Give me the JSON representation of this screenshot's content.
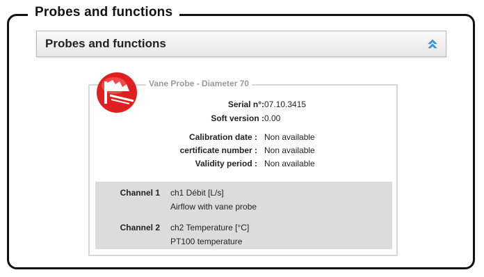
{
  "outer_title": "Probes and functions",
  "panel": {
    "title": "Probes and functions",
    "collapse_icon": "double-chevron-up-icon"
  },
  "probe": {
    "name": "Vane Probe - Diameter 70",
    "icon": "vane-probe-icon",
    "info": [
      {
        "label": "Serial n°:",
        "value": "07.10.3415"
      },
      {
        "label": "Soft version :",
        "value": "0.00"
      }
    ],
    "calibration": [
      {
        "label": "Calibration date :",
        "value": "Non available"
      },
      {
        "label": "certificate number :",
        "value": "Non available"
      },
      {
        "label": "Validity period :",
        "value": "Non available"
      }
    ],
    "channels": [
      {
        "label": "Channel 1",
        "line1": "ch1 Débit [L/s]",
        "line2": "Airflow with vane probe"
      },
      {
        "label": "Channel 2",
        "line1": "ch2 Temperature [°C]",
        "line2": "PT100 temperature"
      }
    ]
  },
  "colors": {
    "accent_red": "#e02020",
    "collapse_icon_blue": "#3aa0e0",
    "channel_bg": "#dcdcdc"
  }
}
